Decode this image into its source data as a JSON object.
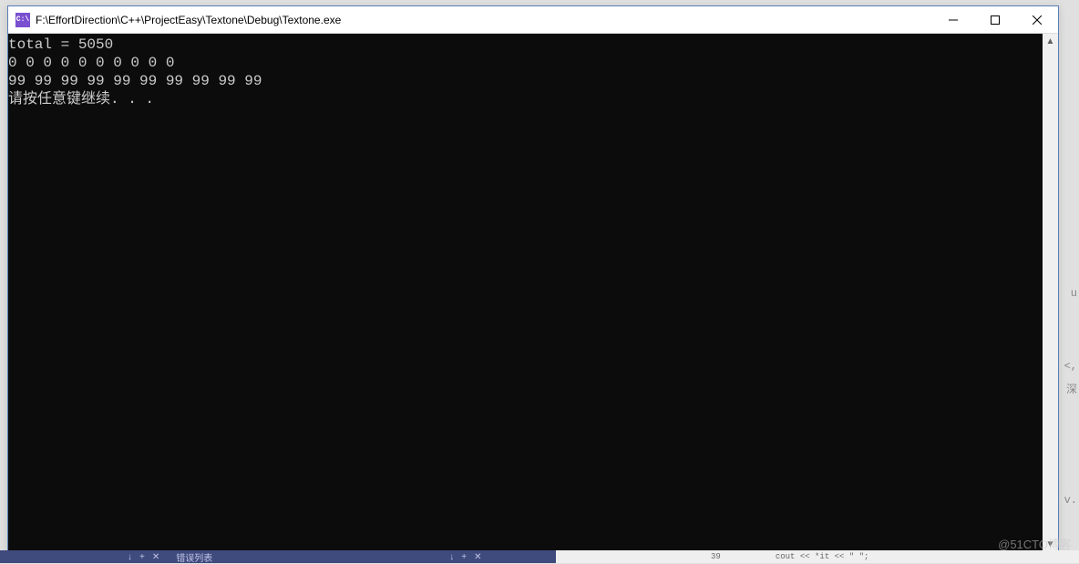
{
  "window": {
    "icon_text": "C:\\",
    "title": "F:\\EffortDirection\\C++\\ProjectEasy\\Textone\\Debug\\Textone.exe"
  },
  "console": {
    "line1": "total = 5050",
    "line2": "0 0 0 0 0 0 0 0 0 0 ",
    "line3": "99 99 99 99 99 99 99 99 99 99 ",
    "line4": "请按任意键继续. . ."
  },
  "scrollbar": {
    "up": "▲",
    "down": "▼"
  },
  "background": {
    "frag1": "u",
    "frag2": "<,",
    "frag3": "深",
    "frag4": "v."
  },
  "bottom": {
    "tab_label": "错误列表",
    "code_frag": "cout << *it << \" \";",
    "line_num": "39"
  },
  "watermark": "@51CTO博客"
}
